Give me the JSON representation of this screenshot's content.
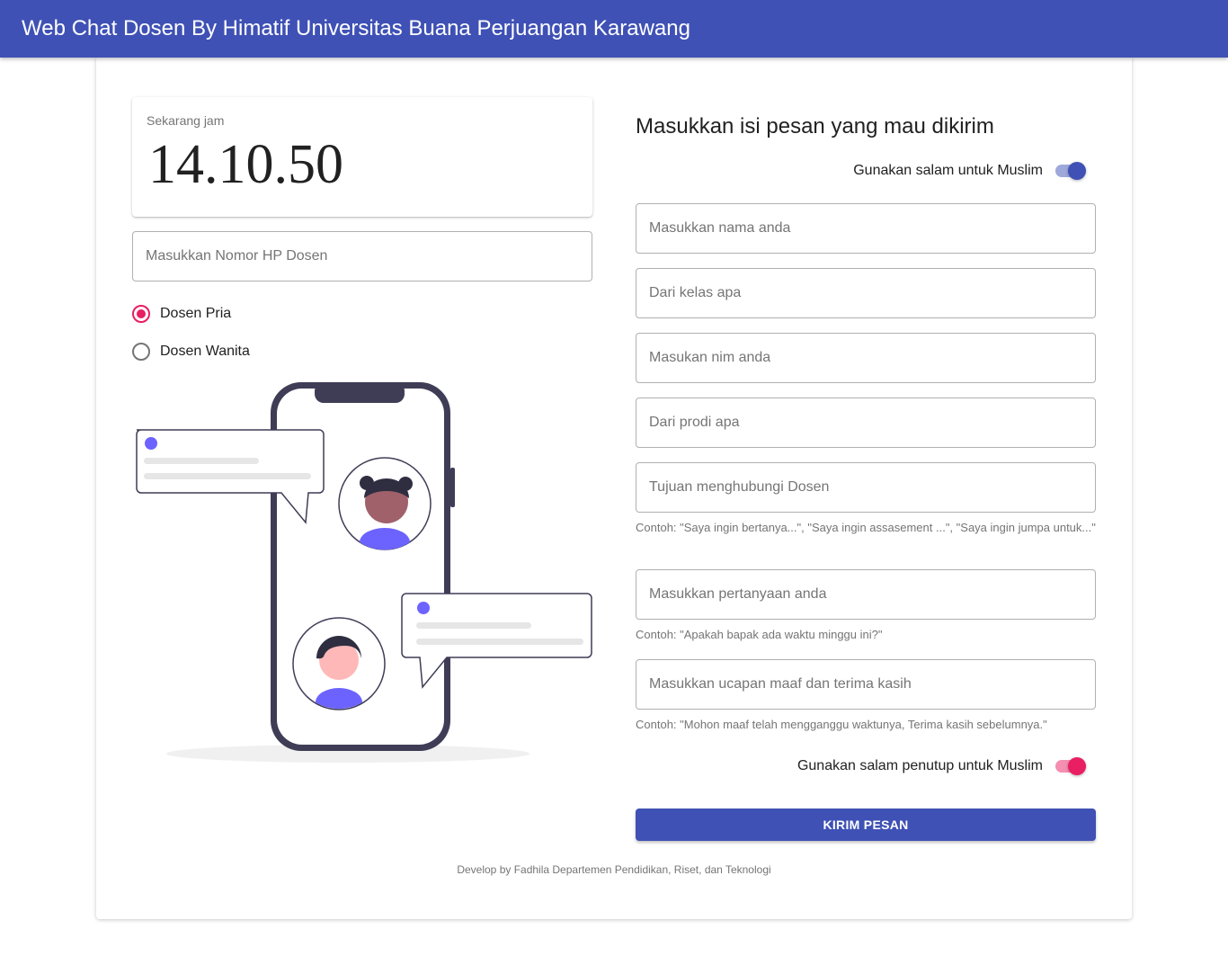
{
  "appbar": {
    "title": "Web Chat Dosen By Himatif Universitas Buana Perjuangan Karawang",
    "color": "#3f51b5"
  },
  "clock": {
    "label": "Sekarang jam",
    "time": "14.10.50"
  },
  "dosen_phone": {
    "placeholder": "Masukkan Nomor HP Dosen",
    "value": ""
  },
  "gender": {
    "options": [
      {
        "label": "Dosen Pria",
        "checked": true
      },
      {
        "label": "Dosen Wanita",
        "checked": false
      }
    ]
  },
  "form": {
    "heading": "Masukkan isi pesan yang mau dikirim",
    "salam_toggle": {
      "label": "Gunakan salam untuk Muslim",
      "on": true,
      "color": "#3f51b5"
    },
    "fields": {
      "nama": {
        "placeholder": "Masukkan nama anda",
        "value": ""
      },
      "kelas": {
        "placeholder": "Dari kelas apa",
        "value": ""
      },
      "nim": {
        "placeholder": "Masukan nim anda",
        "value": ""
      },
      "prodi": {
        "placeholder": "Dari prodi apa",
        "value": ""
      },
      "tujuan": {
        "placeholder": "Tujuan menghubungi Dosen",
        "value": "",
        "hint": "Contoh: \"Saya ingin bertanya...\", \"Saya ingin assasement ...\", \"Saya ingin jumpa untuk...\""
      },
      "pertanyaan": {
        "placeholder": "Masukkan pertanyaan anda",
        "value": "",
        "hint": "Contoh: \"Apakah bapak ada waktu minggu ini?\""
      },
      "ucapan": {
        "placeholder": "Masukkan ucapan maaf dan terima kasih",
        "value": "",
        "hint": "Contoh: \"Mohon maaf telah mengganggu waktunya, Terima kasih sebelumnya.\""
      }
    },
    "penutup_toggle": {
      "label": "Gunakan salam penutup untuk Muslim",
      "on": true,
      "color": "#e91e63"
    },
    "submit_label": "KIRIM PESAN"
  },
  "footer": "Develop by Fadhila Departemen Pendidikan, Riset, dan Teknologi",
  "illustration": {
    "icon": "chat-phone-illustration",
    "accent": "#6c63ff",
    "phone_color": "#3f3d56"
  }
}
